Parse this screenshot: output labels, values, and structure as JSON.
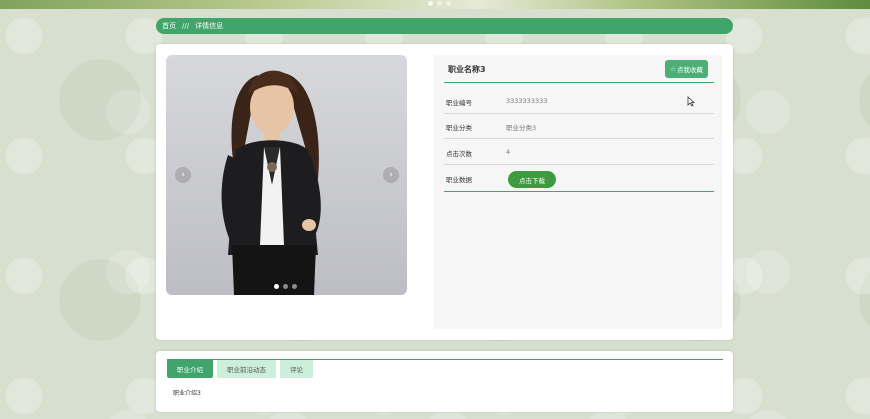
{
  "banner": {
    "dot_count": 3,
    "active_dot": 1
  },
  "breadcrumb": {
    "home": "首页",
    "separator": "///",
    "current": "详情信息"
  },
  "detail": {
    "title": "职业名称3",
    "favorite_label": "点我收藏",
    "rows": [
      {
        "key": "职业编号",
        "value": "3333333333"
      },
      {
        "key": "职业分类",
        "value": "职业分类3"
      },
      {
        "key": "点击次数",
        "value": "4"
      },
      {
        "key": "职业数据",
        "button": "点击下载"
      }
    ]
  },
  "carousel": {
    "prev_icon": "chevron-left-icon",
    "next_icon": "chevron-right-icon",
    "slides": 3,
    "active": 1
  },
  "tabs": {
    "items": [
      {
        "label": "职业介绍",
        "active": true
      },
      {
        "label": "职业前沿动态",
        "active": false
      },
      {
        "label": "评论",
        "active": false
      }
    ],
    "content": "职业介绍3"
  },
  "colors": {
    "accent": "#3fa56a",
    "download": "#3f9b3f",
    "tab_inactive": "#cdeedb"
  }
}
